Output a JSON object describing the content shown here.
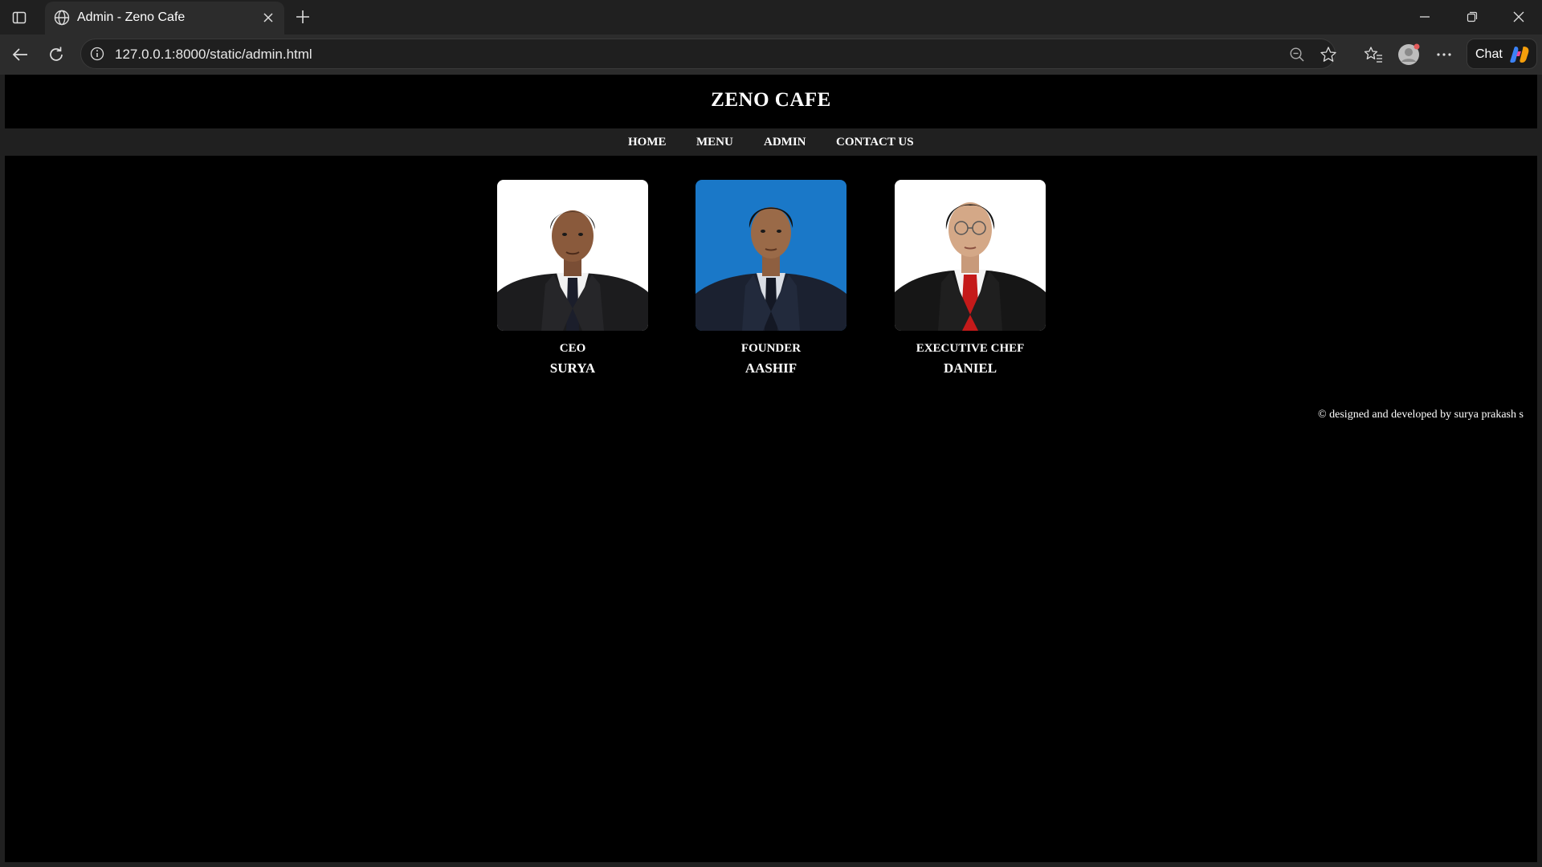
{
  "browser": {
    "tab": {
      "title": "Admin - Zeno Cafe"
    },
    "address": {
      "url": "127.0.0.1:8000/static/admin.html"
    },
    "chat_label": "Chat"
  },
  "site": {
    "title": "ZENO CAFE",
    "nav": [
      "HOME",
      "MENU",
      "ADMIN",
      "CONTACT US"
    ],
    "team": [
      {
        "role": "CEO",
        "name": "SURYA"
      },
      {
        "role": "FOUNDER",
        "name": "AASHIF"
      },
      {
        "role": "EXECUTIVE CHEF",
        "name": "DANIEL"
      }
    ],
    "footer": "© designed and developed by surya prakash s"
  },
  "colors": {
    "page_bg": "#000000",
    "nav_bg": "#202020",
    "photo2_bg": "#1a78c8"
  }
}
